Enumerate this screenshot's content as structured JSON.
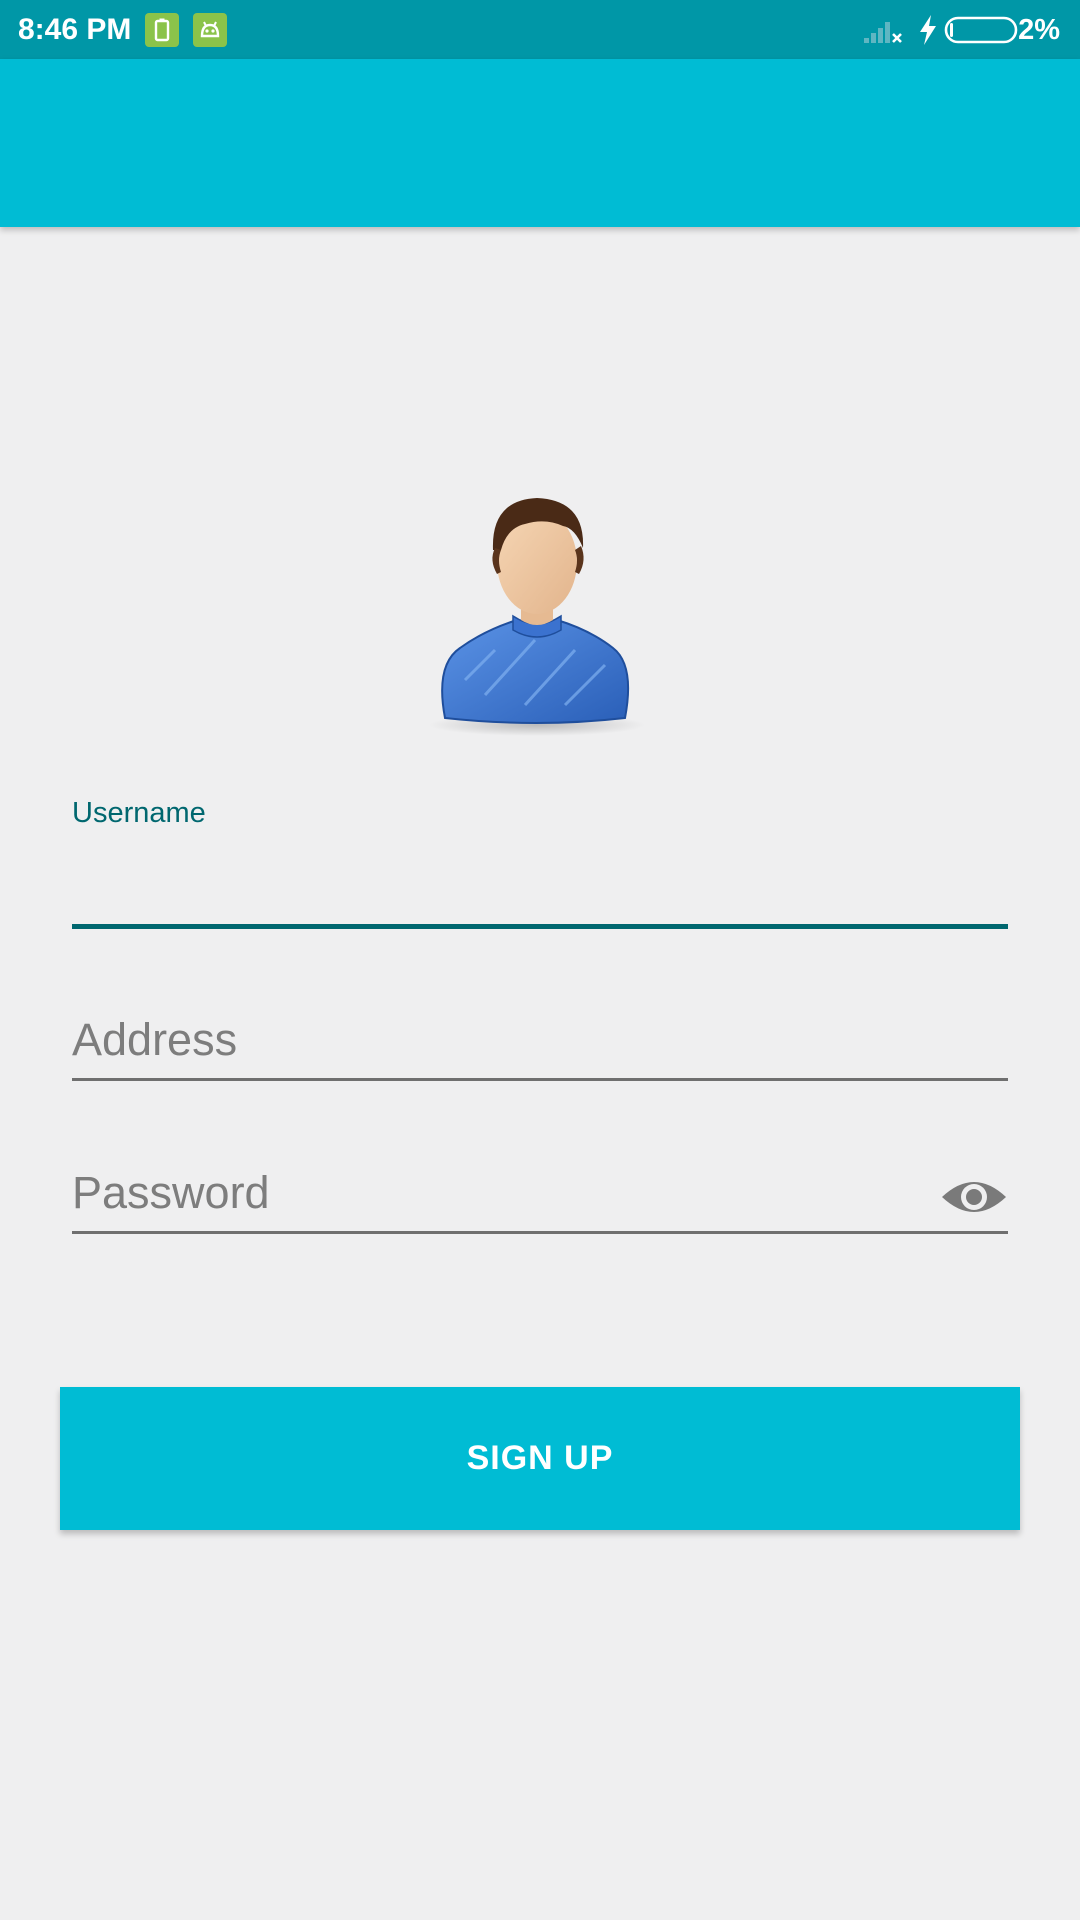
{
  "status_bar": {
    "time": "8:46 PM",
    "battery_percent": "2%",
    "icons": [
      "battery-saver-icon",
      "android-debug-icon",
      "no-signal-icon",
      "charging-bolt-icon",
      "battery-icon"
    ]
  },
  "colors": {
    "status_bar": "#0097A7",
    "app_bar": "#00BCD4",
    "accent": "#00676F",
    "background": "#EFEFF0",
    "button": "#00BCD4",
    "button_text": "#FFFFFF"
  },
  "form": {
    "avatar_icon": "user-avatar-icon",
    "username": {
      "label": "Username",
      "value": ""
    },
    "address": {
      "placeholder": "Address",
      "value": ""
    },
    "password": {
      "placeholder": "Password",
      "value": "",
      "toggle_icon": "eye-icon"
    },
    "signup_label": "SIGN UP"
  }
}
